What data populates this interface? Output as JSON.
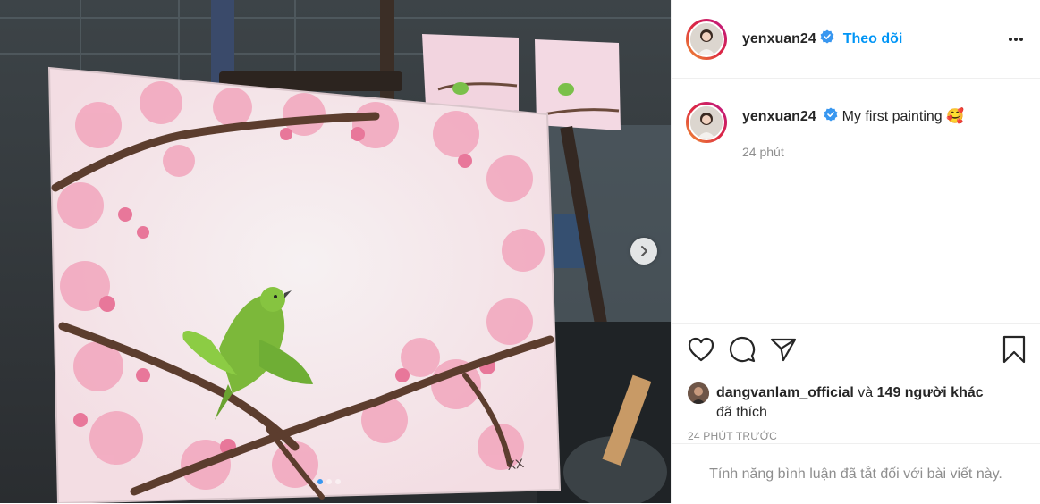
{
  "colors": {
    "accent": "#0095f6",
    "verified": "#3897f0",
    "text": "#262626",
    "muted": "#8e8e8e"
  },
  "media": {
    "icons": {
      "next": "chevron-right-icon"
    },
    "carousel": {
      "total": 3,
      "current": 1
    }
  },
  "header": {
    "username": "yenxuan24",
    "follow_label": "Theo dõi",
    "more_icon": "more-horizontal-icon",
    "verified_icon": "verified-badge-icon"
  },
  "caption": {
    "username": "yenxuan24",
    "text": "My first painting",
    "emoji": "🥰",
    "time": "24 phút"
  },
  "actions": {
    "icons": [
      "heart-icon",
      "comment-icon",
      "share-icon",
      "bookmark-icon"
    ]
  },
  "likes": {
    "first_user": "dangvanlam_official",
    "conjunction": "và",
    "others": "149 người khác",
    "suffix": "đã thích"
  },
  "posted": "24 PHÚT TRƯỚC",
  "comments_off": "Tính năng bình luận đã tắt đối với bài viết này."
}
